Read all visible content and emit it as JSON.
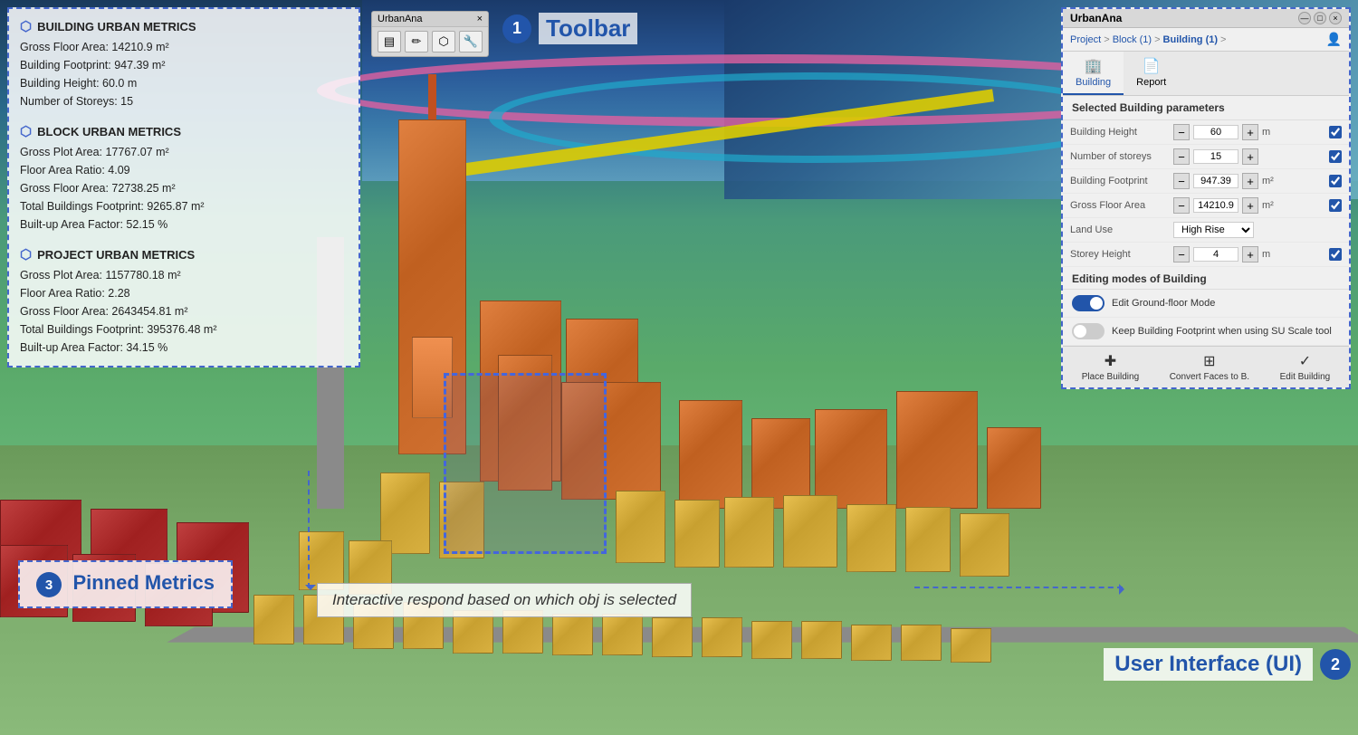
{
  "app": {
    "name": "UrbanAna",
    "title": "UrbanAna"
  },
  "toolbar": {
    "window_title": "UrbanAna",
    "close_btn": "×",
    "buttons": [
      "▤",
      "✏",
      "🏠",
      "🔧"
    ],
    "annotation_num": "1",
    "annotation_label": "Toolbar"
  },
  "metrics": {
    "building_title": "BUILDING URBAN METRICS",
    "building_lines": [
      "Gross Floor Area: 14210.9 m²",
      "Building Footprint: 947.39 m²",
      "Building Height: 60.0 m",
      "Number of Storeys: 15"
    ],
    "block_title": "BLOCK URBAN METRICS",
    "block_lines": [
      "Gross Plot Area: 17767.07 m²",
      "Floor Area Ratio: 4.09",
      "Gross Floor Area: 72738.25 m²",
      "Total Buildings Footprint: 9265.87 m²",
      "Built-up Area Factor: 52.15 %"
    ],
    "project_title": "PROJECT URBAN METRICS",
    "project_lines": [
      "Gross Plot Area: 1157780.18 m²",
      "Floor Area Ratio: 2.28",
      "Gross Floor Area: 2643454.81 m²",
      "Total Buildings Footprint: 395376.48 m²",
      "Built-up Area Factor: 34.15 %"
    ]
  },
  "pinned": {
    "num": "3",
    "label": "Pinned Metrics"
  },
  "interactive_label": "Interactive respond based on which obj is selected",
  "ui_panel": {
    "title": "UrbanAna",
    "breadcrumb": {
      "project": "Project",
      "sep1": ">",
      "block": "Block (1)",
      "sep2": ">",
      "building": "Building (1)",
      "sep3": ">"
    },
    "tabs": [
      {
        "id": "building",
        "label": "Building",
        "icon": "🏢"
      },
      {
        "id": "report",
        "label": "Report",
        "icon": "📄"
      }
    ],
    "active_tab": "building",
    "section_title": "Selected Building parameters",
    "params": [
      {
        "label": "Building Height",
        "value": "60",
        "unit": "m",
        "has_check": true,
        "type": "number"
      },
      {
        "label": "Number of storeys",
        "value": "15",
        "unit": "",
        "has_check": true,
        "type": "number"
      },
      {
        "label": "Building Footprint",
        "value": "947.39",
        "unit": "m²",
        "has_check": true,
        "type": "number"
      },
      {
        "label": "Gross Floor Area",
        "value": "14210.9",
        "unit": "m²",
        "has_check": true,
        "type": "number"
      },
      {
        "label": "Land Use",
        "value": "High Rise",
        "unit": "",
        "has_check": false,
        "type": "dropdown"
      },
      {
        "label": "Storey Height",
        "value": "4",
        "unit": "m",
        "has_check": true,
        "type": "number"
      }
    ],
    "editing_title": "Editing modes of Building",
    "edit_modes": [
      {
        "label": "Edit Ground-floor Mode",
        "toggled": true
      },
      {
        "label": "Keep Building Footprint when using SU Scale tool",
        "toggled": false
      }
    ],
    "footer_btns": [
      {
        "label": "Place Building",
        "icon": "+"
      },
      {
        "label": "Convert Faces to B.",
        "icon": "⊞"
      },
      {
        "label": "Edit Building",
        "icon": "✓"
      }
    ]
  },
  "ui_annotation": {
    "num": "2",
    "label": "User Interface (UI)"
  }
}
